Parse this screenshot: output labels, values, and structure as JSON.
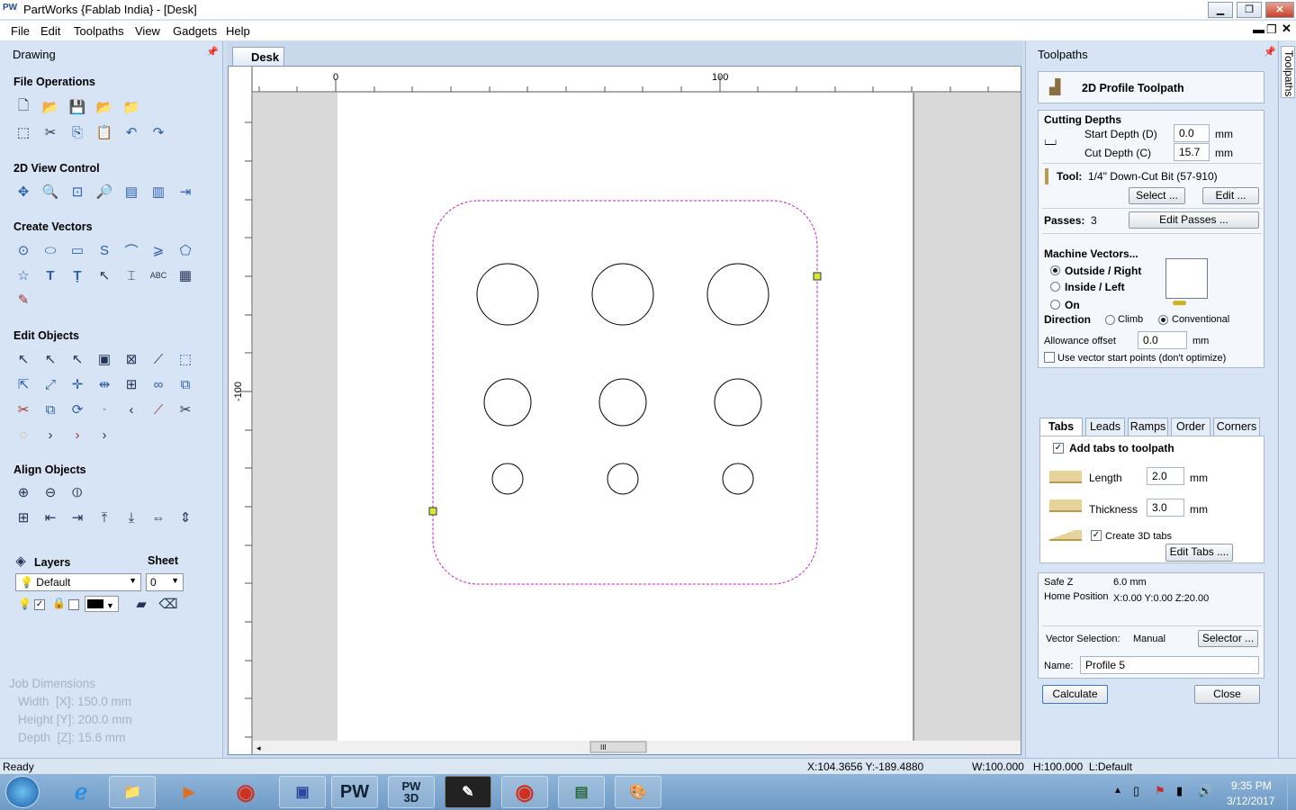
{
  "app": {
    "icon": "PW",
    "title": "PartWorks {Fablab India} - [Desk]"
  },
  "menu": [
    "File",
    "Edit",
    "Toolpaths",
    "View",
    "Gadgets",
    "Help"
  ],
  "left": {
    "panel_title": "Drawing",
    "sections": {
      "file_ops": "File Operations",
      "view_2d": "2D View Control",
      "create_vectors": "Create Vectors",
      "edit_objects": "Edit Objects",
      "align_objects": "Align Objects"
    },
    "layers": {
      "label": "Layers",
      "sheet_label": "Sheet",
      "layer_value": "Default",
      "sheet_value": "0"
    },
    "job": {
      "title": "Job Dimensions",
      "width": "Width  [X]: 150.0 mm",
      "height": "Height [Y]: 200.0 mm",
      "depth": "Depth  [Z]: 15.6 mm"
    }
  },
  "doc": {
    "tab": "Desk",
    "ruler_h": [
      "0",
      "100"
    ],
    "ruler_v": "-100",
    "scroll_thumb": "III"
  },
  "right": {
    "panel_title": "Toolpaths",
    "side_tab": "Toolpaths",
    "header": "2D Profile Toolpath",
    "cutting_depths": "Cutting Depths",
    "start_depth_label": "Start Depth (D)",
    "start_depth": "0.0",
    "cut_depth_label": "Cut Depth (C)",
    "cut_depth": "15.7",
    "unit": "mm",
    "tool_label": "Tool:",
    "tool_name": "1/4\"  Down-Cut Bit (57-910)",
    "select_btn": "Select ...",
    "edit_btn": "Edit ...",
    "passes_label": "Passes:",
    "passes": "3",
    "edit_passes_btn": "Edit Passes ...",
    "machine_vectors": "Machine Vectors...",
    "outside_right": "Outside / Right",
    "inside_left": "Inside / Left",
    "on": "On",
    "direction": "Direction",
    "climb": "Climb",
    "conventional": "Conventional",
    "allowance_label": "Allowance offset",
    "allowance": "0.0",
    "use_start_points": "Use vector start points (don't optimize)",
    "tabs": [
      "Tabs",
      "Leads",
      "Ramps",
      "Order",
      "Corners"
    ],
    "add_tabs": "Add tabs to toolpath",
    "length_label": "Length",
    "length": "2.0",
    "thickness_label": "Thickness",
    "thickness": "3.0",
    "create_3d_tabs": "Create 3D tabs",
    "edit_tabs_btn": "Edit Tabs ....",
    "safe_z_label": "Safe Z",
    "safe_z": "6.0 mm",
    "home_label": "Home Position",
    "home": "X:0.00 Y:0.00 Z:20.00",
    "vector_sel_label": "Vector Selection:",
    "vector_sel": "Manual",
    "selector_btn": "Selector ...",
    "name_label": "Name:",
    "name": "Profile 5",
    "calculate_btn": "Calculate",
    "close_btn": "Close"
  },
  "status": {
    "ready": "Ready",
    "coords": "X:104.3656 Y:-189.4880",
    "wh": "W:100.000   H:100.000  L:Default"
  },
  "taskbar": {
    "pw": "PW",
    "pw3d": "PW\n3D",
    "time": "9:35 PM",
    "date": "3/12/2017"
  }
}
